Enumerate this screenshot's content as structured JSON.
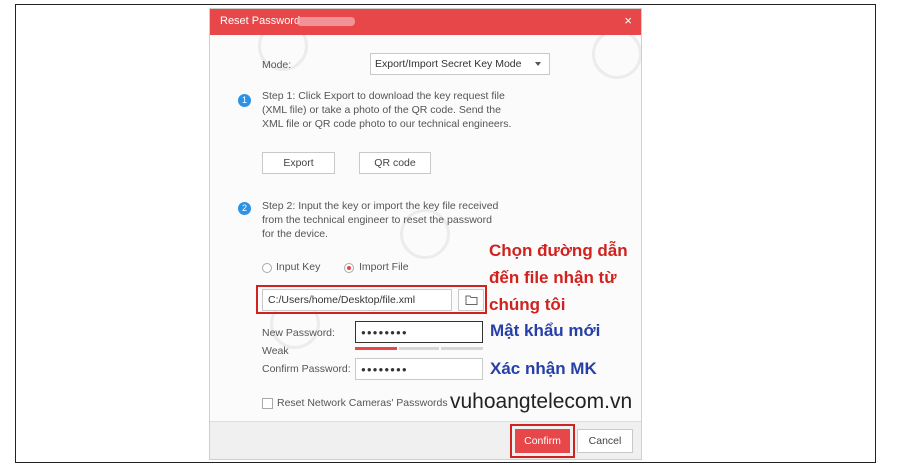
{
  "dialog": {
    "title": "Reset Password",
    "close_glyph": "×",
    "mode_label": "Mode:",
    "mode_value": "Export/Import Secret Key Mode",
    "step1": {
      "number": "1",
      "text": "Step 1: Click Export to download the key request file (XML file) or take a photo of the QR code. Send the XML file or QR code photo to our technical engineers.",
      "export_label": "Export",
      "qr_label": "QR code"
    },
    "step2": {
      "number": "2",
      "text": "Step 2: Input the key or import the key file received from the technical engineer to reset the password for the device.",
      "option_input_key": "Input Key",
      "option_import_file": "Import File",
      "selected_option": "Import File",
      "file_path": "C:/Users/home/Desktop/file.xml"
    },
    "new_password_label": "New Password:",
    "new_password_value": "●●●●●●●●",
    "strength_label": "Weak",
    "confirm_password_label": "Confirm Password:",
    "confirm_password_value": "●●●●●●●●",
    "reset_cameras_label": "Reset Network Cameras' Passwords",
    "confirm_label": "Confirm",
    "cancel_label": "Cancel"
  },
  "annotations": {
    "choose_path_line1": "Chọn đường dẫn",
    "choose_path_line2": "đến file nhận từ",
    "choose_path_line3": "chúng tôi",
    "new_password": "Mật khẩu mới",
    "confirm_password": "Xác nhận MK",
    "website": "vuhoangtelecom.vn"
  },
  "colors": {
    "accent": "#e8474a",
    "step_badge": "#2a93e8",
    "annotation_red": "#d0221f",
    "annotation_blue": "#2740a8"
  },
  "icons": {
    "folder": "folder-icon",
    "dropdown": "chevron-down-icon",
    "close": "close-icon"
  }
}
